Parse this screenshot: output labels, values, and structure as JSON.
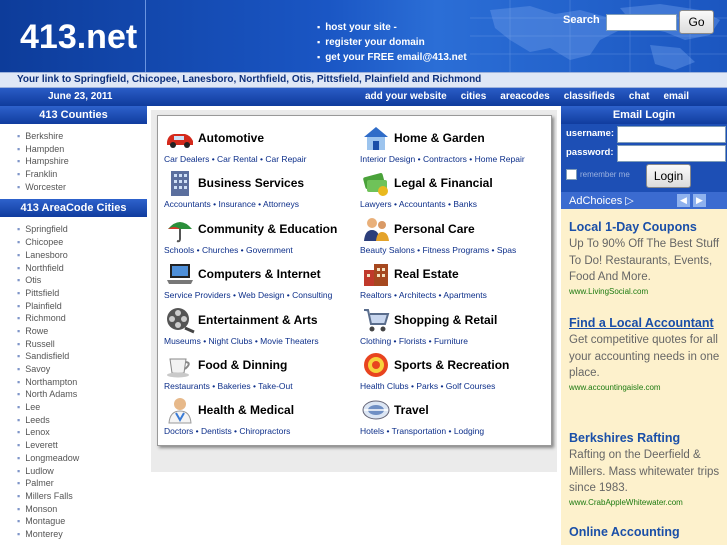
{
  "header": {
    "logo": "413.net",
    "promo": [
      "host your site -",
      "register your domain",
      "get your FREE email@413.net"
    ],
    "search_label": "Search",
    "search_value": "",
    "go_label": "Go"
  },
  "tagline": "Your link to Springfield, Chicopee, Lanesboro, Northfield, Otis, Pittsfield, Plainfield and Richmond",
  "navbar": {
    "date": "June 23, 2011",
    "links": [
      "add your website",
      "cities",
      "areacodes",
      "classifieds",
      "chat",
      "email"
    ]
  },
  "left": {
    "counties_title": "413 Counties",
    "counties": [
      "Berkshire",
      "Hampden",
      "Hampshire",
      "Franklin",
      "Worcester"
    ],
    "cities_title": "413 AreaCode Cities",
    "cities": [
      "Springfield",
      "Chicopee",
      "Lanesboro",
      "Northfield",
      "Otis",
      "Pittsfield",
      "Plainfield",
      "Richmond",
      "Rowe",
      "Russell",
      "Sandisfield",
      "Savoy",
      "Northampton",
      "North Adams",
      "Lee",
      "Leeds",
      "Lenox",
      "Leverett",
      "Longmeadow",
      "Ludlow",
      "Palmer",
      "Millers Falls",
      "Monson",
      "Montague",
      "Monterey"
    ]
  },
  "categories": [
    {
      "title": "Automotive",
      "subs": "Car Dealers • Car Rental • Car Repair",
      "icon": "car-icon"
    },
    {
      "title": "Home & Garden",
      "subs": "Interior Design • Contractors • Home Repair",
      "icon": "house-icon"
    },
    {
      "title": "Business Services",
      "subs": "Accountants • Insurance • Attorneys",
      "icon": "office-building-icon"
    },
    {
      "title": "Legal & Financial",
      "subs": "Lawyers • Accountants • Banks",
      "icon": "money-icon"
    },
    {
      "title": "Community & Education",
      "subs": "Schools • Churches • Government",
      "icon": "umbrella-icon"
    },
    {
      "title": "Personal Care",
      "subs": "Beauty Salons • Fitness Programs • Spas",
      "icon": "people-icon"
    },
    {
      "title": "Computers & Internet",
      "subs": "Service Providers • Web Design • Consulting",
      "icon": "laptop-icon"
    },
    {
      "title": "Real Estate",
      "subs": "Realtors • Architects • Apartments",
      "icon": "buildings-icon"
    },
    {
      "title": "Entertainment & Arts",
      "subs": "Museums • Night Clubs • Movie Theaters",
      "icon": "film-reel-icon"
    },
    {
      "title": "Shopping & Retail",
      "subs": "Clothing • Florists • Furniture",
      "icon": "shopping-cart-icon"
    },
    {
      "title": "Food & Dinning",
      "subs": "Restaurants • Bakeries • Take-Out",
      "icon": "coffee-cup-icon"
    },
    {
      "title": "Sports & Recreation",
      "subs": "Health Clubs • Parks • Golf Courses",
      "icon": "target-icon"
    },
    {
      "title": "Health & Medical",
      "subs": "Doctors • Dentists • Chiropractors",
      "icon": "doctor-icon"
    },
    {
      "title": "Travel",
      "subs": "Hotels • Transportation • Lodging",
      "icon": "globe-icon"
    }
  ],
  "login": {
    "title": "Email Login",
    "username_label": "username:",
    "password_label": "password:",
    "remember_label": "remember me",
    "login_label": "Login"
  },
  "ad": {
    "adchoices": "AdChoices",
    "items": [
      {
        "title": "Local 1-Day Coupons",
        "body": "Up To 90% Off The Best Stuff To Do! Restaurants, Events, Food And More.",
        "url": "www.LivingSocial.com"
      },
      {
        "title": "Find a Local Accountant",
        "body": "Get competitive quotes for all your accounting needs in one place.",
        "url": "www.accountingaisle.com"
      },
      {
        "title": "Berkshires Rafting",
        "body": "Rafting on the Deerfield & Millers. Mass whitewater trips since 1983.",
        "url": "www.CrabAppleWhitewater.com"
      },
      {
        "title": "Online Accounting",
        "body": "",
        "url": ""
      }
    ]
  },
  "colors": {
    "header_blue": "#1a56c4",
    "nav_blue": "#103c9e",
    "ad_background": "#fdf1cc",
    "ad_title": "#1a4fa8",
    "ad_url": "#1c7a10"
  }
}
